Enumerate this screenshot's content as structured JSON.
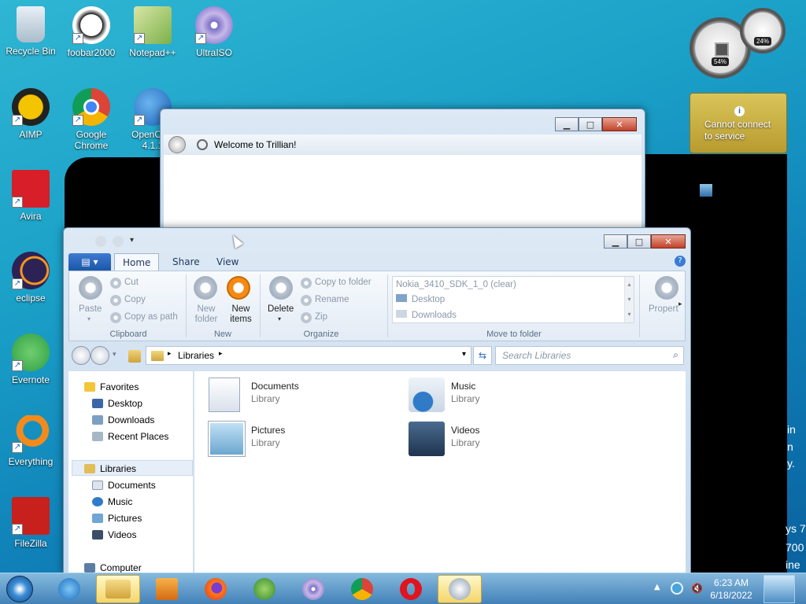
{
  "desktop_icons": [
    {
      "label": "Recycle Bin"
    },
    {
      "label": "foobar2000"
    },
    {
      "label": "Notepad++"
    },
    {
      "label": "UltraISO"
    },
    {
      "label": "AIMP"
    },
    {
      "label": "Google Chrome"
    },
    {
      "label": "OpenOf… 4.1.1"
    },
    {
      "label": "Avira"
    },
    {
      "label": "eclipse"
    },
    {
      "label": "Evernote"
    },
    {
      "label": "Everything"
    },
    {
      "label": "FileZilla"
    }
  ],
  "gadgets": {
    "cpu_percent": "54%",
    "mem_percent": "24%",
    "weather_message": "Cannot connect to service"
  },
  "trillian": {
    "message": "Welcome to Trillian!"
  },
  "explorer": {
    "tabs": {
      "file": "",
      "home": "Home",
      "share": "Share",
      "view": "View"
    },
    "clipboard": {
      "paste": "Paste",
      "cut": "Cut",
      "copy": "Copy",
      "copy_as_path": "Copy as path",
      "group": "Clipboard"
    },
    "new": {
      "new_folder": "New folder",
      "new_items": "New items",
      "group": "New"
    },
    "organize": {
      "delete": "Delete",
      "copy_to_folder": "Copy to folder",
      "rename": "Rename",
      "zip": "Zip",
      "group": "Organize"
    },
    "move_to": {
      "items": [
        "Nokia_3410_SDK_1_0 (clear)",
        "Desktop",
        "Downloads"
      ],
      "group": "Move to folder"
    },
    "properties": "Propert",
    "address": {
      "path": "Libraries"
    },
    "search": {
      "placeholder": "Search Libraries"
    },
    "nav": {
      "favorites": "Favorites",
      "desktop": "Desktop",
      "downloads": "Downloads",
      "recent": "Recent Places",
      "libraries": "Libraries",
      "documents": "Documents",
      "music": "Music",
      "pictures": "Pictures",
      "videos": "Videos",
      "computer": "Computer"
    },
    "libraries": [
      {
        "name": "Documents",
        "sub": "Library"
      },
      {
        "name": "Music",
        "sub": "Library"
      },
      {
        "name": "Pictures",
        "sub": "Library"
      },
      {
        "name": "Videos",
        "sub": "Library"
      }
    ]
  },
  "right_fragments": [
    "in",
    "n",
    "y.",
    "ys 7",
    "700",
    "ine"
  ],
  "clock": {
    "time": "6:23 AM",
    "date": "6/18/2022"
  }
}
